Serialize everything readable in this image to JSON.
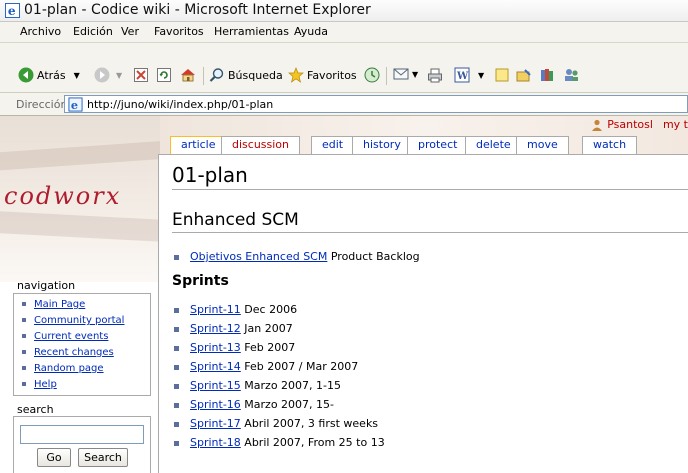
{
  "window": {
    "title": "01-plan - Codice wiki - Microsoft Internet Explorer"
  },
  "menu": [
    "Archivo",
    "Edición",
    "Ver",
    "Favoritos",
    "Herramientas",
    "Ayuda"
  ],
  "toolbar": {
    "back_label": "Atrás",
    "search_label": "Búsqueda",
    "favorites_label": "Favoritos"
  },
  "address": {
    "label": "Dirección",
    "url": "http://juno/wiki/index.php/01-plan"
  },
  "user": {
    "name": "Psantosl",
    "talk": "my t"
  },
  "tabs": [
    "article",
    "discussion",
    "edit",
    "history",
    "protect",
    "delete",
    "move",
    "watch"
  ],
  "logo": {
    "text": "codworx"
  },
  "page": {
    "title": "01-plan",
    "section1": "Enhanced SCM",
    "backlog": {
      "link": "Objetivos Enhanced SCM",
      "text": " Product Backlog"
    },
    "section2": "Sprints",
    "sprints": [
      {
        "link": "Sprint-11",
        "text": " Dec 2006"
      },
      {
        "link": "Sprint-12",
        "text": " Jan 2007"
      },
      {
        "link": "Sprint-13",
        "text": " Feb 2007"
      },
      {
        "link": "Sprint-14",
        "text": " Feb 2007 / Mar 2007"
      },
      {
        "link": "Sprint-15",
        "text": " Marzo 2007, 1-15"
      },
      {
        "link": "Sprint-16",
        "text": " Marzo 2007, 15-"
      },
      {
        "link": "Sprint-17",
        "text": " Abril 2007, 3 first weeks"
      },
      {
        "link": "Sprint-18",
        "text": " Abril 2007, From 25 to 13"
      }
    ]
  },
  "sidebar": {
    "nav_title": "navigation",
    "nav": [
      "Main Page",
      "Community portal",
      "Current events",
      "Recent changes",
      "Random page",
      "Help"
    ],
    "search_title": "search",
    "go_label": "Go",
    "search_label": "Search"
  }
}
